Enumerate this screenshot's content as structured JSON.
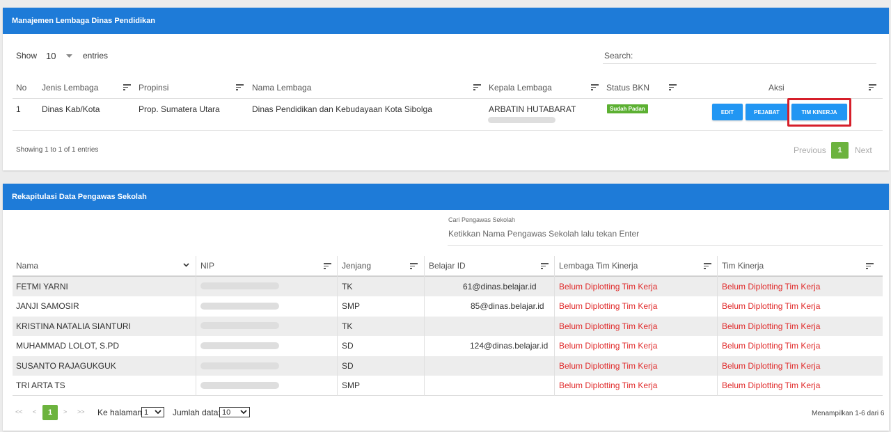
{
  "lembaga": {
    "title": "Manajemen Lembaga Dinas Pendidikan",
    "show_label": "Show",
    "entries_value": "10",
    "entries_label": "entries",
    "search_label": "Search:",
    "columns": [
      "No",
      "Jenis Lembaga",
      "Propinsi",
      "Nama Lembaga",
      "Kepala Lembaga",
      "Status BKN",
      "Aksi"
    ],
    "row": {
      "no": "1",
      "jenis": "Dinas Kab/Kota",
      "propinsi": "Prop. Sumatera Utara",
      "nama": "Dinas Pendidikan dan Kebudayaan Kota Sibolga",
      "kepala": "ARBATIN HUTABARAT",
      "status": "Sudah Padan",
      "actions": [
        "EDIT",
        "PEJABAT",
        "TIM KINERJA"
      ]
    },
    "showing": "Showing 1 to 1 of 1 entries",
    "pagination": {
      "previous": "Previous",
      "current": "1",
      "next": "Next"
    }
  },
  "pengawas": {
    "title": "Rekapitulasi Data Pengawas Sekolah",
    "search_caption": "Cari Pengawas Sekolah",
    "search_placeholder": "Ketikkan Nama Pengawas Sekolah lalu tekan Enter",
    "columns": [
      "Nama",
      "NIP",
      "Jenjang",
      "Belajar ID",
      "Lembaga Tim Kinerja",
      "Tim Kinerja"
    ],
    "rows": [
      {
        "nama": "FETMI YARNI",
        "jenjang": "TK",
        "belajar_id": "61@dinas.belajar.id",
        "lembaga": "Belum Diplotting Tim Kerja",
        "tim": "Belum Diplotting Tim Kerja"
      },
      {
        "nama": "JANJI SAMOSIR",
        "jenjang": "SMP",
        "belajar_id": "85@dinas.belajar.id",
        "lembaga": "Belum Diplotting Tim Kerja",
        "tim": "Belum Diplotting Tim Kerja"
      },
      {
        "nama": "KRISTINA NATALIA SIANTURI",
        "jenjang": "TK",
        "belajar_id": "",
        "lembaga": "Belum Diplotting Tim Kerja",
        "tim": "Belum Diplotting Tim Kerja"
      },
      {
        "nama": "MUHAMMAD LOLOT, S.PD",
        "jenjang": "SD",
        "belajar_id": "124@dinas.belajar.id",
        "lembaga": "Belum Diplotting Tim Kerja",
        "tim": "Belum Diplotting Tim Kerja"
      },
      {
        "nama": "SUSANTO RAJAGUKGUK",
        "jenjang": "SD",
        "belajar_id": "",
        "lembaga": "Belum Diplotting Tim Kerja",
        "tim": "Belum Diplotting Tim Kerja"
      },
      {
        "nama": "TRI ARTA TS",
        "jenjang": "SMP",
        "belajar_id": "",
        "lembaga": "Belum Diplotting Tim Kerja",
        "tim": "Belum Diplotting Tim Kerja"
      }
    ],
    "pager": {
      "first": "<<",
      "prev": "<",
      "current": "1",
      "next": ">",
      "last": ">>"
    },
    "ke_halaman_label": "Ke halaman:",
    "ke_halaman_value": "1",
    "jumlah_label": "Jumlah data:",
    "jumlah_value": "10",
    "summary": "Menampilkan 1-6 dari 6"
  },
  "colors": {
    "header_blue": "#1e7bd8",
    "button_blue": "#2196f3",
    "status_green": "#5cb032",
    "warning_red": "#e02b2b",
    "highlight_red": "#d61f2a"
  }
}
